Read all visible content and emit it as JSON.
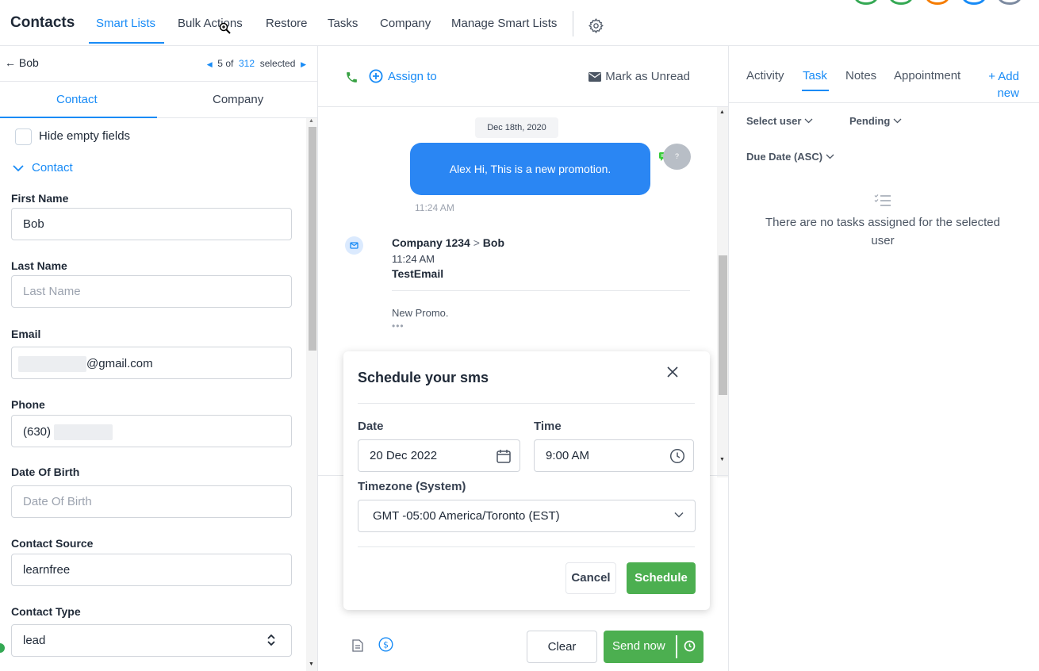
{
  "topnav": {
    "brand": "Contacts",
    "items": [
      "Smart Lists",
      "Bulk Actions",
      "Restore",
      "Tasks",
      "Company",
      "Manage Smart Lists"
    ],
    "active_index": 0,
    "avatar_colors": [
      "#34a853",
      "#34a853",
      "#f57c00",
      "#188bf6",
      "#7c8aa0"
    ]
  },
  "contact_panel": {
    "back_label": "Bob",
    "pager": {
      "current": "5",
      "of_label": "of",
      "total": "312",
      "suffix": "selected"
    },
    "tabs": [
      "Contact",
      "Company"
    ],
    "hide_empty_label": "Hide empty fields",
    "section_label": "Contact",
    "fields": [
      {
        "label": "First Name",
        "value": "Bob",
        "placeholder": ""
      },
      {
        "label": "Last Name",
        "value": "",
        "placeholder": "Last Name"
      },
      {
        "label": "Email",
        "value": "@gmail.com",
        "placeholder": ""
      },
      {
        "label": "Phone",
        "value": "(630)",
        "placeholder": ""
      },
      {
        "label": "Date Of Birth",
        "value": "",
        "placeholder": "Date Of Birth"
      },
      {
        "label": "Contact Source",
        "value": "learnfree",
        "placeholder": ""
      },
      {
        "label": "Contact Type",
        "value": "lead",
        "placeholder": ""
      }
    ]
  },
  "conversation": {
    "assign_label": "Assign to",
    "mark_unread_label": "Mark as Unread",
    "date_pill": "Dec 18th, 2020",
    "message_text": "Alex Hi, This is a new promotion.",
    "message_time": "11:24 AM",
    "avatar_initial": "?",
    "email": {
      "from": "Company 1234",
      "separator": ">",
      "to": "Bob",
      "time": "11:24 AM",
      "subject": "TestEmail",
      "body": "New Promo.",
      "more": "•••"
    },
    "clear_label": "Clear",
    "send_label": "Send now"
  },
  "schedule_modal": {
    "title": "Schedule your sms",
    "date_label": "Date",
    "date_value": "20 Dec 2022",
    "time_label": "Time",
    "time_value": "9:00 AM",
    "timezone_label": "Timezone (System)",
    "timezone_value": "GMT -05:00 America/Toronto (EST)",
    "cancel_label": "Cancel",
    "schedule_label": "Schedule"
  },
  "side_panel": {
    "tabs": [
      "Activity",
      "Task",
      "Notes",
      "Appointment"
    ],
    "active_index": 1,
    "add_label_line1": "+ Add",
    "add_label_line2": "new",
    "filter_user": "Select user",
    "filter_status": "Pending",
    "filter_sort": "Due Date (ASC)",
    "empty_message": "There are no tasks assigned for the selected user"
  },
  "colors": {
    "accent": "#188bf6",
    "send_green": "#4caf50",
    "bubble_blue": "#2a86f3"
  }
}
